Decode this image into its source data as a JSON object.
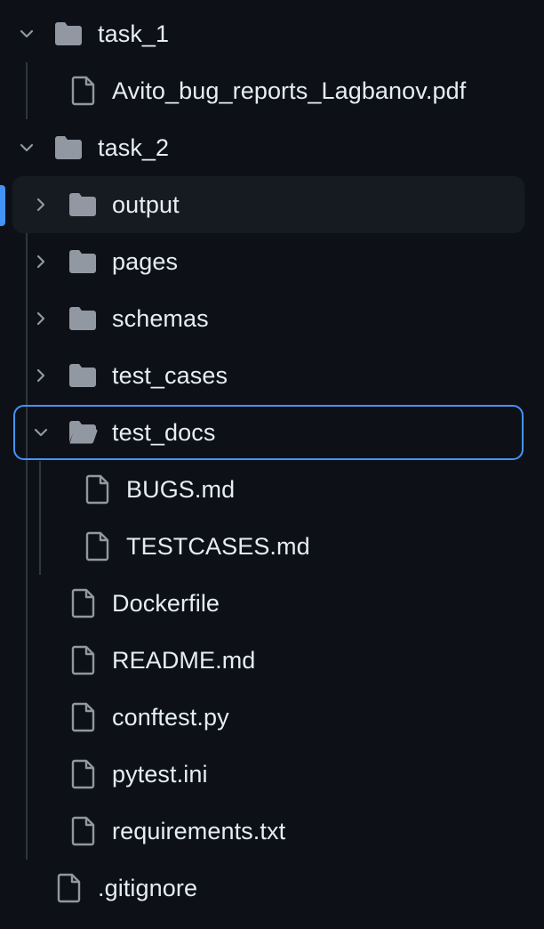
{
  "tree": {
    "items": [
      {
        "label": "task_1",
        "kind": "folder",
        "expanded": true
      },
      {
        "label": "Avito_bug_reports_Lagbanov.pdf",
        "kind": "file"
      },
      {
        "label": "task_2",
        "kind": "folder",
        "expanded": true
      },
      {
        "label": "output",
        "kind": "folder",
        "expanded": false,
        "selected": true
      },
      {
        "label": "pages",
        "kind": "folder",
        "expanded": false
      },
      {
        "label": "schemas",
        "kind": "folder",
        "expanded": false
      },
      {
        "label": "test_cases",
        "kind": "folder",
        "expanded": false
      },
      {
        "label": "test_docs",
        "kind": "folder",
        "expanded": true,
        "focused": true
      },
      {
        "label": "BUGS.md",
        "kind": "file"
      },
      {
        "label": "TESTCASES.md",
        "kind": "file"
      },
      {
        "label": "Dockerfile",
        "kind": "file"
      },
      {
        "label": "README.md",
        "kind": "file"
      },
      {
        "label": "conftest.py",
        "kind": "file"
      },
      {
        "label": "pytest.ini",
        "kind": "file"
      },
      {
        "label": "requirements.txt",
        "kind": "file"
      },
      {
        "label": ".gitignore",
        "kind": "file"
      }
    ]
  },
  "colors": {
    "background": "#0d1117",
    "selected_row": "#161b22",
    "focus_ring": "#4493f8",
    "icon": "#9198a1",
    "text": "#e6edf3"
  },
  "icons": {
    "folder": "folder-icon",
    "file": "file-icon",
    "collapse": "chevron-down-icon",
    "expand": "chevron-right-icon"
  }
}
